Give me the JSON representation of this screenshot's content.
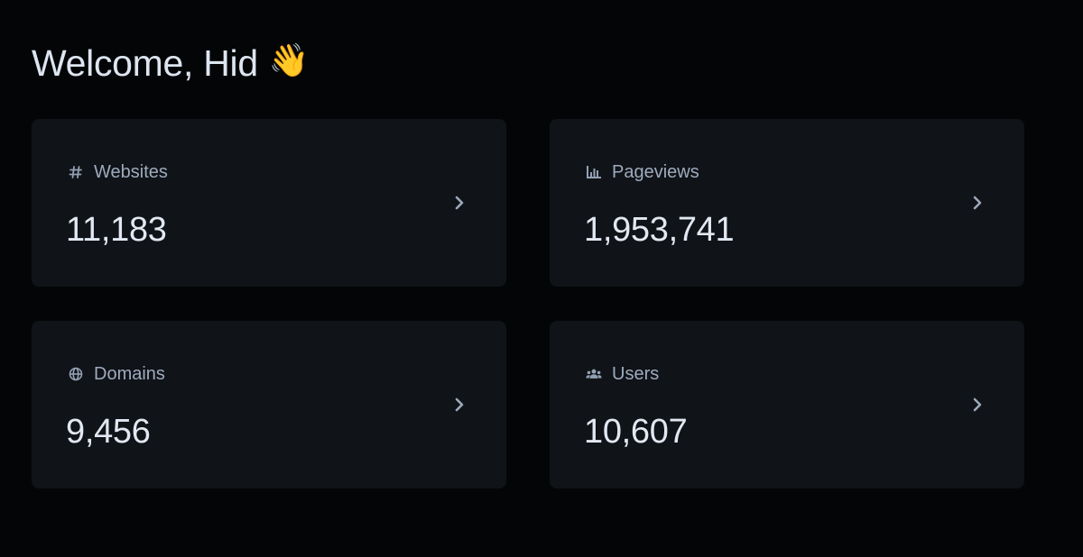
{
  "header": {
    "greeting": "Welcome, Hid",
    "emoji": "👋"
  },
  "stats": [
    {
      "label": "Websites",
      "value": "11,183",
      "icon": "hash-icon"
    },
    {
      "label": "Pageviews",
      "value": "1,953,741",
      "icon": "bar-chart-icon"
    },
    {
      "label": "Domains",
      "value": "9,456",
      "icon": "globe-icon"
    },
    {
      "label": "Users",
      "value": "10,607",
      "icon": "users-icon"
    }
  ],
  "colors": {
    "background": "#040507",
    "card": "#101317",
    "text_primary": "#e2e8f2",
    "text_secondary": "#9eabbf"
  }
}
